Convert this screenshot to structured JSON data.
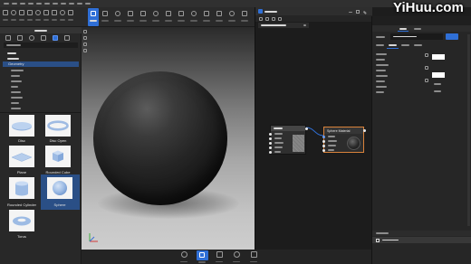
{
  "watermark": {
    "text": "YiHuu.com"
  },
  "asset_panel": {
    "selected_category": "Geometry",
    "shapes": [
      {
        "label": "Disc",
        "icon": "disc-icon",
        "selected": false
      },
      {
        "label": "Disc Open",
        "icon": "disc-open-icon",
        "selected": false
      },
      {
        "label": "Plane",
        "icon": "plane-icon",
        "selected": false
      },
      {
        "label": "Rounded Cube",
        "icon": "rounded-cube-icon",
        "selected": false
      },
      {
        "label": "Rounded Cylinder",
        "icon": "rounded-cylinder-icon",
        "selected": false
      },
      {
        "label": "Sphere",
        "icon": "sphere-icon",
        "selected": true
      },
      {
        "label": "Torus",
        "icon": "torus-icon",
        "selected": false
      }
    ]
  },
  "node_editor": {
    "material_node": {
      "title": "Sphere Material",
      "selected": true
    }
  },
  "colors": {
    "accent": "#2f6fd6",
    "selection": "#2a4f86",
    "selected_node_border": "#d9823b",
    "color_swatch": "#ffffff"
  }
}
